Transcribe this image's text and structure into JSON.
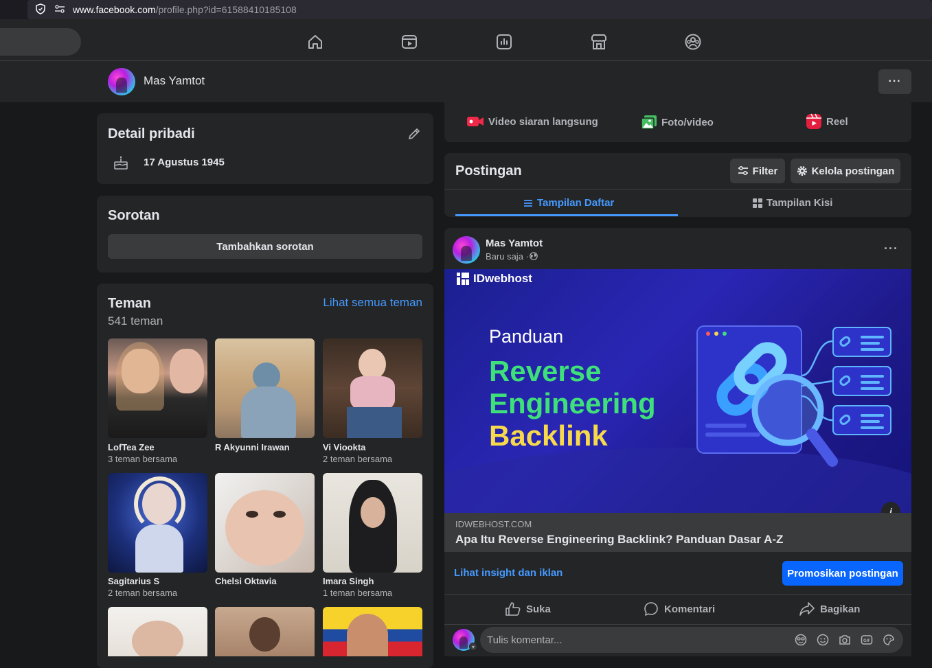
{
  "browser": {
    "url_host": "www.facebook.com",
    "url_path": "/profile.php?id=61588410185108"
  },
  "profile_bar": {
    "name": "Mas Yamtot",
    "more_label": "···"
  },
  "detail": {
    "title": "Detail pribadi",
    "birthday": "17 Agustus 1945"
  },
  "highlights": {
    "title": "Sorotan",
    "add_button": "Tambahkan sorotan"
  },
  "friends": {
    "title": "Teman",
    "count": "541 teman",
    "see_all": "Lihat semua teman",
    "items": [
      {
        "name": "LofTea Zee",
        "mutual": "3 teman bersama"
      },
      {
        "name": "R Akyunni Irawan",
        "mutual": ""
      },
      {
        "name": "Vi Viookta",
        "mutual": "2 teman bersama"
      },
      {
        "name": "Sagitarius S",
        "mutual": "2 teman bersama"
      },
      {
        "name": "Chelsi Oktavia",
        "mutual": ""
      },
      {
        "name": "Imara Singh",
        "mutual": "1 teman bersama"
      }
    ]
  },
  "composer": {
    "live": "Video siaran langsung",
    "photo": "Foto/video",
    "reel": "Reel"
  },
  "posts": {
    "title": "Postingan",
    "filter": "Filter",
    "manage": "Kelola postingan",
    "tab_list": "Tampilan Daftar",
    "tab_grid": "Tampilan Kisi"
  },
  "post": {
    "author": "Mas Yamtot",
    "time": "Baru saja ·",
    "image": {
      "brand": "IDwebhost",
      "line1": "Panduan",
      "line2": "Reverse",
      "line3": "Engineering",
      "line4": "Backlink"
    },
    "domain": "IDWEBHOST.COM",
    "headline": "Apa Itu Reverse Engineering Backlink? Panduan Dasar A-Z",
    "insight": "Lihat insight dan iklan",
    "promote": "Promosikan postingan",
    "like": "Suka",
    "comment": "Komentari",
    "share": "Bagikan",
    "comment_placeholder": "Tulis komentar..."
  },
  "colors": {
    "accent": "#0866ff",
    "link": "#4599ff",
    "card": "#242526",
    "bg": "#18191a",
    "green_text": "#3ee07a",
    "yellow_text": "#f7d94c"
  }
}
